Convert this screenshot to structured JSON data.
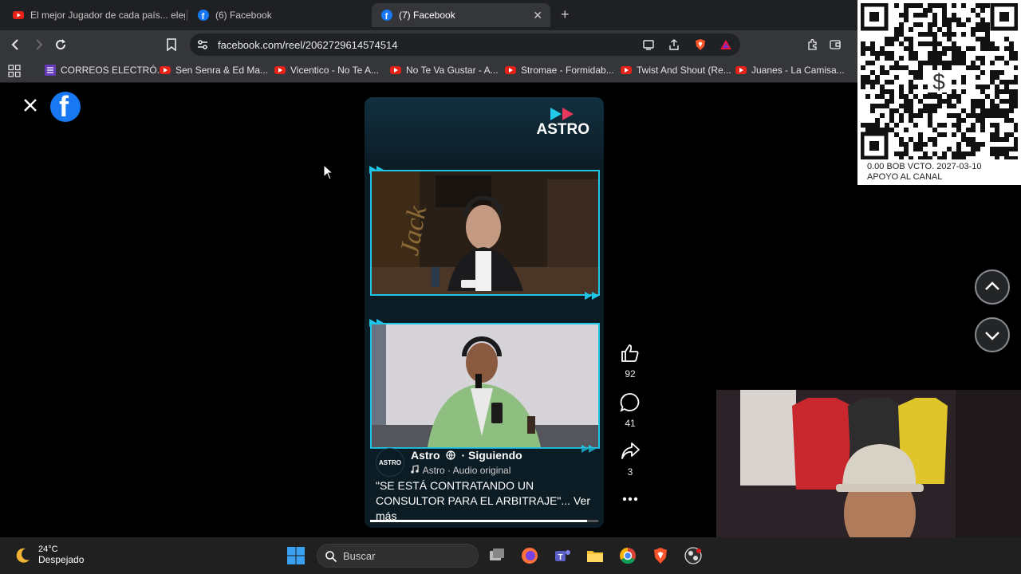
{
  "browser": {
    "tabs": [
      {
        "title": "El mejor Jugador de cada país... elegi",
        "icon": "youtube-icon",
        "active": false
      },
      {
        "title": "(6) Facebook",
        "icon": "facebook-icon",
        "active": false
      },
      {
        "title": "(7) Facebook",
        "icon": "facebook-icon",
        "active": true
      }
    ],
    "new_tab_label": "+",
    "close_tab_label": "✕",
    "url": "facebook.com/reel/2062729614574514"
  },
  "bookmarks": [
    {
      "label": "CORREOS ELECTRÓ...",
      "icon": "list-icon"
    },
    {
      "label": "Sen Senra & Ed Ma...",
      "icon": "youtube-icon"
    },
    {
      "label": "Vicentico - No Te A...",
      "icon": "youtube-icon"
    },
    {
      "label": "No Te Va Gustar - A...",
      "icon": "youtube-icon"
    },
    {
      "label": "Stromae - Formidab...",
      "icon": "youtube-icon"
    },
    {
      "label": "Twist And Shout (Re...",
      "icon": "youtube-icon"
    },
    {
      "label": "Juanes - La Camisa...",
      "icon": "youtube-icon"
    }
  ],
  "reel": {
    "brand": "ASTRO",
    "author_avatar_text": "ASTRO",
    "author": "Astro",
    "follow_status": "· Siguiendo",
    "audio": "Astro · Audio original",
    "caption": "\"SE ESTÁ CONTRATANDO UN CONSULTOR PARA EL ARBITRAJE\"...",
    "see_more": "Ver más",
    "progress": 0.95
  },
  "actions": {
    "likes": "92",
    "comments": "41",
    "shares": "3"
  },
  "overlay": {
    "qr_line1": "0.00 BOB   VCTO. 2027-03-10",
    "qr_line2": "APOYO AL CANAL"
  },
  "taskbar": {
    "temperature": "24°C",
    "weather": "Despejado",
    "search_placeholder": "Buscar"
  },
  "colors": {
    "facebook_blue": "#1877f2",
    "reel_frame_cyan": "#20c5e6",
    "brave_orange": "#fb542b"
  }
}
